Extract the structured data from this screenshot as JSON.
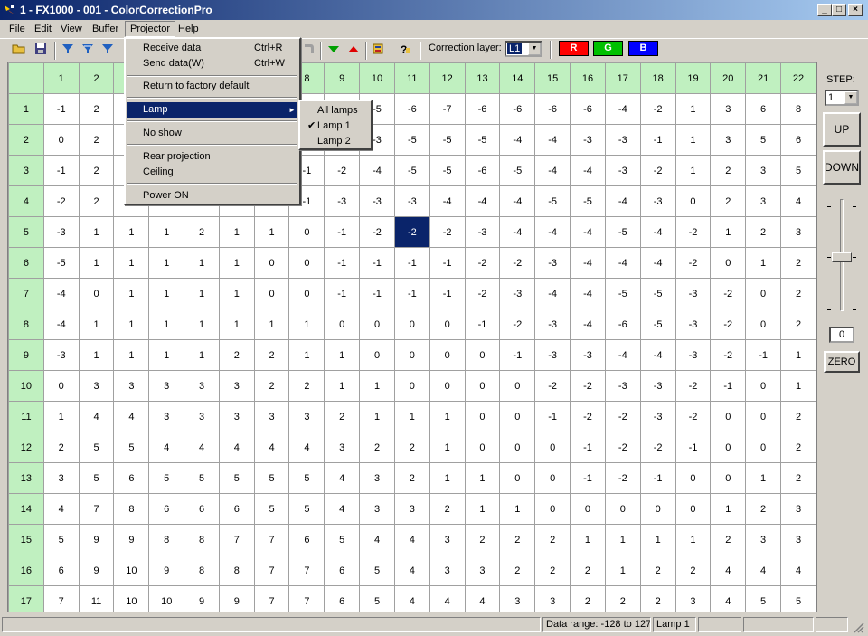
{
  "window": {
    "title": "1 - FX1000 - 001 - ColorCorrectionPro"
  },
  "menubar": [
    "File",
    "Edit",
    "View",
    "Buffer",
    "Projector",
    "Help"
  ],
  "toolbar": {
    "correction_layer_label": "Correction layer:",
    "layer_value": "L1",
    "r_label": "R",
    "g_label": "G",
    "b_label": "B",
    "r_color": "#ff0000",
    "g_color": "#00c000",
    "b_color": "#0000ff"
  },
  "grid": {
    "columns": [
      "1",
      "2",
      "3",
      "4",
      "5",
      "6",
      "7",
      "8",
      "9",
      "10",
      "11",
      "12",
      "13",
      "14",
      "15",
      "16",
      "17",
      "18",
      "19",
      "20",
      "21",
      "22"
    ],
    "rows": [
      [
        "1",
        [
          -1,
          2,
          null,
          null,
          null,
          null,
          null,
          null,
          null,
          -5,
          -6,
          -7,
          -6,
          -6,
          -6,
          -6,
          -4,
          -2,
          1,
          3,
          6,
          8
        ]
      ],
      [
        "2",
        [
          0,
          2,
          null,
          null,
          null,
          null,
          null,
          null,
          null,
          -3,
          -5,
          -5,
          -5,
          -4,
          -4,
          -3,
          -3,
          -1,
          1,
          3,
          5,
          6
        ]
      ],
      [
        "3",
        [
          -1,
          2,
          null,
          null,
          null,
          null,
          null,
          -1,
          -2,
          -4,
          -5,
          -5,
          -6,
          -5,
          -4,
          -4,
          -3,
          -2,
          1,
          2,
          3,
          5
        ]
      ],
      [
        "4",
        [
          -2,
          2,
          null,
          null,
          null,
          null,
          null,
          -1,
          -3,
          -3,
          -3,
          -4,
          -4,
          -4,
          -5,
          -5,
          -4,
          -3,
          0,
          2,
          3,
          4
        ]
      ],
      [
        "5",
        [
          -3,
          1,
          1,
          1,
          2,
          1,
          1,
          0,
          -1,
          -2,
          -2,
          -2,
          -3,
          -4,
          -4,
          -4,
          -5,
          -4,
          -2,
          1,
          2,
          3
        ]
      ],
      [
        "6",
        [
          -5,
          1,
          1,
          1,
          1,
          1,
          0,
          0,
          -1,
          -1,
          -1,
          -1,
          -2,
          -2,
          -3,
          -4,
          -4,
          -4,
          -2,
          0,
          1,
          2
        ]
      ],
      [
        "7",
        [
          -4,
          0,
          1,
          1,
          1,
          1,
          0,
          0,
          -1,
          -1,
          -1,
          -1,
          -2,
          -3,
          -4,
          -4,
          -5,
          -5,
          -3,
          -2,
          0,
          2
        ]
      ],
      [
        "8",
        [
          -4,
          1,
          1,
          1,
          1,
          1,
          1,
          1,
          0,
          0,
          0,
          0,
          -1,
          -2,
          -3,
          -4,
          -6,
          -5,
          -3,
          -2,
          0,
          2
        ]
      ],
      [
        "9",
        [
          -3,
          1,
          1,
          1,
          1,
          2,
          2,
          1,
          1,
          0,
          0,
          0,
          0,
          -1,
          -3,
          -3,
          -4,
          -4,
          -3,
          -2,
          -1,
          1
        ]
      ],
      [
        "10",
        [
          0,
          3,
          3,
          3,
          3,
          3,
          2,
          2,
          1,
          1,
          0,
          0,
          0,
          0,
          -2,
          -2,
          -3,
          -3,
          -2,
          -1,
          0,
          1
        ]
      ],
      [
        "11",
        [
          1,
          4,
          4,
          3,
          3,
          3,
          3,
          3,
          2,
          1,
          1,
          1,
          0,
          0,
          -1,
          -2,
          -2,
          -3,
          -2,
          0,
          0,
          2
        ]
      ],
      [
        "12",
        [
          2,
          5,
          5,
          4,
          4,
          4,
          4,
          4,
          3,
          2,
          2,
          1,
          0,
          0,
          0,
          -1,
          -2,
          -2,
          -1,
          0,
          0,
          2
        ]
      ],
      [
        "13",
        [
          3,
          5,
          6,
          5,
          5,
          5,
          5,
          5,
          4,
          3,
          2,
          1,
          1,
          0,
          0,
          -1,
          -2,
          -1,
          0,
          0,
          1,
          2
        ]
      ],
      [
        "14",
        [
          4,
          7,
          8,
          6,
          6,
          6,
          5,
          5,
          4,
          3,
          3,
          2,
          1,
          1,
          0,
          0,
          0,
          0,
          0,
          1,
          2,
          3
        ]
      ],
      [
        "15",
        [
          5,
          9,
          9,
          8,
          8,
          7,
          7,
          6,
          5,
          4,
          4,
          3,
          2,
          2,
          2,
          1,
          1,
          1,
          1,
          2,
          3,
          3
        ]
      ],
      [
        "16",
        [
          6,
          9,
          10,
          9,
          8,
          8,
          7,
          7,
          6,
          5,
          4,
          3,
          3,
          2,
          2,
          2,
          1,
          2,
          2,
          4,
          4,
          4
        ]
      ],
      [
        "17",
        [
          7,
          11,
          10,
          10,
          9,
          9,
          7,
          7,
          6,
          5,
          4,
          4,
          4,
          3,
          3,
          2,
          2,
          2,
          3,
          4,
          5,
          5
        ]
      ]
    ],
    "selected": {
      "row": "5",
      "col": "11"
    }
  },
  "right_panel": {
    "step_label": "STEP:",
    "step_value": "1",
    "up_label": "UP",
    "down_label": "DOWN",
    "slider_value": "0",
    "zero_label": "ZERO"
  },
  "statusbar": {
    "data_range": "Data range: -128 to 127",
    "lamp": "Lamp 1"
  },
  "projector_menu": {
    "receive": "Receive data",
    "receive_shortcut": "Ctrl+R",
    "send": "Send data(W)",
    "send_shortcut": "Ctrl+W",
    "factory": "Return to factory default",
    "lamp": "Lamp",
    "no_show": "No show",
    "rear": "Rear projection",
    "ceiling": "Ceiling",
    "power": "Power ON"
  },
  "lamp_submenu": {
    "all": "All lamps",
    "lamp1": "Lamp 1",
    "lamp2": "Lamp 2",
    "checked": "Lamp 1"
  }
}
